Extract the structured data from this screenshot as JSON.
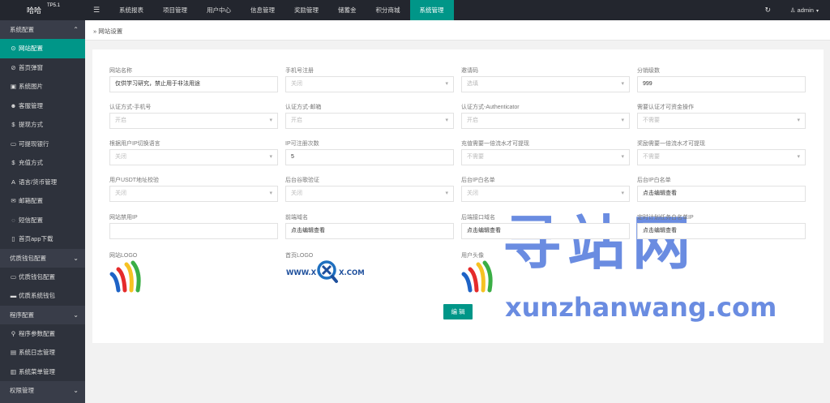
{
  "app": {
    "name": "哈哈",
    "version": "TP5.1"
  },
  "topnav": [
    "系统报表",
    "项目管理",
    "用户中心",
    "信息管理",
    "奖励管理",
    "储蓄金",
    "积分商城",
    "系统管理"
  ],
  "user": {
    "name": "admin"
  },
  "sidebar": {
    "group1": "系统配置",
    "group1_items": [
      {
        "icon": "⊙",
        "label": "网站配置"
      },
      {
        "icon": "⊘",
        "label": "首页弹窗"
      },
      {
        "icon": "▣",
        "label": "系统图片"
      },
      {
        "icon": "☻",
        "label": "客服管理"
      },
      {
        "icon": "$",
        "label": "提现方式"
      },
      {
        "icon": "▭",
        "label": "可提现银行"
      },
      {
        "icon": "$",
        "label": "充值方式"
      },
      {
        "icon": "A",
        "label": "语言/货币管理"
      },
      {
        "icon": "✉",
        "label": "邮箱配置"
      },
      {
        "icon": "◌",
        "label": "短信配置"
      },
      {
        "icon": "▯",
        "label": "首页app下载"
      }
    ],
    "group2": "优质钱包配置",
    "group2_items": [
      {
        "icon": "▭",
        "label": "优质钱包配置"
      },
      {
        "icon": "▬",
        "label": "优质系统钱包"
      }
    ],
    "group3": "程序配置",
    "group3_items": [
      {
        "icon": "⚲",
        "label": "程序参数配置"
      },
      {
        "icon": "▤",
        "label": "系统日志管理"
      },
      {
        "icon": "▥",
        "label": "系统菜单管理"
      }
    ],
    "group4": "权限管理"
  },
  "breadcrumb": "网站设置",
  "form": {
    "row1": [
      {
        "label": "网站名称",
        "value": "仅供学习研究，禁止用于非法用途",
        "type": "text"
      },
      {
        "label": "手机号注册",
        "value": "关闭",
        "type": "select"
      },
      {
        "label": "邀请码",
        "value": "选填",
        "type": "select"
      },
      {
        "label": "分销级数",
        "value": "999",
        "type": "text"
      }
    ],
    "row2": [
      {
        "label": "认证方式-手机号",
        "value": "开启",
        "type": "select"
      },
      {
        "label": "认证方式-邮箱",
        "value": "开启",
        "type": "select"
      },
      {
        "label": "认证方式-Authenticator",
        "value": "开启",
        "type": "select"
      },
      {
        "label": "需要认证才可资金操作",
        "value": "不需要",
        "type": "select"
      }
    ],
    "row3": [
      {
        "label": "根据用户IP切换语言",
        "value": "关闭",
        "type": "select"
      },
      {
        "label": "IP可注册次数",
        "value": "5",
        "type": "text"
      },
      {
        "label": "充值需要一倍流水才可提现",
        "value": "不需要",
        "type": "select"
      },
      {
        "label": "奖励需要一倍流水才可提现",
        "value": "不需要",
        "type": "select"
      }
    ],
    "row4": [
      {
        "label": "用户USDT地址校验",
        "value": "关闭",
        "type": "select"
      },
      {
        "label": "后台谷歌验证",
        "value": "关闭",
        "type": "select"
      },
      {
        "label": "后台IP白名单",
        "value": "关闭",
        "type": "select"
      },
      {
        "label": "后台IP白名单",
        "value": "点击编辑查看",
        "type": "text"
      }
    ],
    "row5": [
      {
        "label": "网站禁用IP",
        "value": "",
        "type": "text"
      },
      {
        "label": "前端域名",
        "value": "点击编辑查看",
        "type": "text"
      },
      {
        "label": "后端接口域名",
        "value": "点击编辑查看",
        "type": "text"
      },
      {
        "label": "定时计划任务白名单IP",
        "value": "点击编辑查看",
        "type": "text"
      }
    ],
    "logos": [
      {
        "label": "网站LOGO"
      },
      {
        "label": "首页LOGO",
        "text_left": "WWW.X",
        "text_right": "X.COM"
      },
      {
        "label": "用户头像"
      }
    ],
    "edit_button": "编 辑"
  },
  "watermark": {
    "cn": "寻站网",
    "en": "xunzhanwang.com"
  },
  "colors": {
    "topbar": "#23262e",
    "sidebar": "#393d49",
    "accent": "#009688"
  }
}
